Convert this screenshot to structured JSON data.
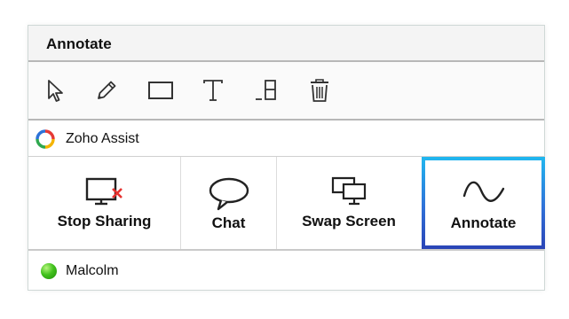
{
  "annotate_panel": {
    "title": "Annotate",
    "tools": [
      {
        "name": "pointer",
        "icon": "cursor-arrow-icon"
      },
      {
        "name": "pen",
        "icon": "pencil-icon"
      },
      {
        "name": "rectangle",
        "icon": "rectangle-icon"
      },
      {
        "name": "text",
        "icon": "text-icon"
      },
      {
        "name": "eraser",
        "icon": "eraser-icon"
      },
      {
        "name": "clear",
        "icon": "trash-icon"
      }
    ]
  },
  "app": {
    "name": "Zoho Assist",
    "logo_icon": "zoho-assist-logo-icon"
  },
  "actions": [
    {
      "label": "Stop Sharing",
      "icon": "stop-sharing-icon"
    },
    {
      "label": "Chat",
      "icon": "chat-bubble-icon"
    },
    {
      "label": "Swap Screen",
      "icon": "swap-screen-icon"
    },
    {
      "label": "Annotate",
      "icon": "annotate-wave-icon",
      "active": true
    }
  ],
  "user": {
    "name": "Malcolm",
    "status_color": "#3fbf1c"
  },
  "colors": {
    "active_border_top": "#20b7ef",
    "active_border_bottom": "#2a44b6",
    "stop_accent": "#e5322f"
  }
}
